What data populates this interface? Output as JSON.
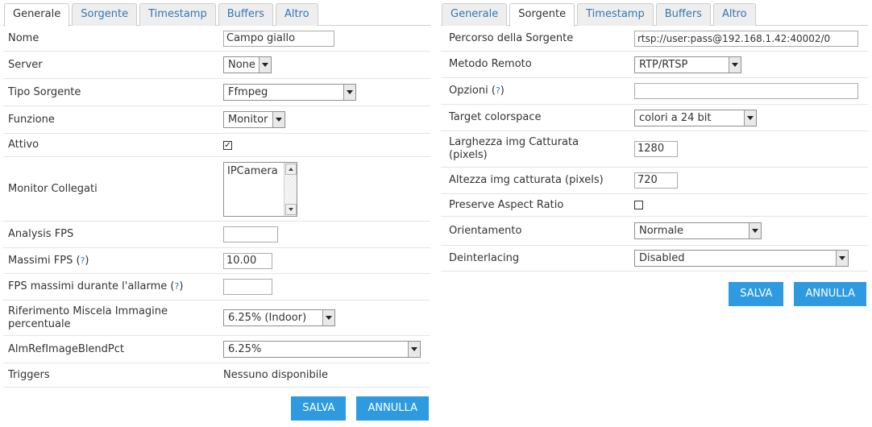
{
  "left": {
    "tabs": [
      "Generale",
      "Sorgente",
      "Timestamp",
      "Buffers",
      "Altro"
    ],
    "active_tab": 0,
    "fields": {
      "nome": {
        "label": "Nome",
        "value": "Campo giallo"
      },
      "server": {
        "label": "Server",
        "value": "None"
      },
      "tipo_sorgente": {
        "label": "Tipo Sorgente",
        "value": "Ffmpeg"
      },
      "funzione": {
        "label": "Funzione",
        "value": "Monitor"
      },
      "attivo": {
        "label": "Attivo",
        "checked": true,
        "check_glyph": "✓"
      },
      "monitor_collegati": {
        "label": "Monitor Collegati",
        "options": [
          "IPCamera"
        ]
      },
      "analysis_fps": {
        "label": "Analysis FPS",
        "value": ""
      },
      "massimi_fps": {
        "label": "Massimi FPS (",
        "help": "?",
        "suffix": ")",
        "value": "10.00"
      },
      "fps_allarme": {
        "label": "FPS massimi durante l'allarme (",
        "help": "?",
        "suffix": ")",
        "value": ""
      },
      "rif_miscela": {
        "label": "Riferimento Miscela Immagine percentuale",
        "value": "6.25% (Indoor)"
      },
      "alm_ref": {
        "label": "AlmRefImageBlendPct",
        "value": "6.25%"
      },
      "triggers": {
        "label": "Triggers",
        "value": "Nessuno disponibile"
      }
    },
    "save_label": "SALVA",
    "cancel_label": "ANNULLA"
  },
  "right": {
    "tabs": [
      "Generale",
      "Sorgente",
      "Timestamp",
      "Buffers",
      "Altro"
    ],
    "active_tab": 1,
    "fields": {
      "percorso": {
        "label": "Percorso della Sorgente",
        "value": "rtsp://user:pass@192.168.1.42:40002/0"
      },
      "metodo": {
        "label": "Metodo Remoto",
        "value": "RTP/RTSP"
      },
      "opzioni": {
        "label": "Opzioni (",
        "help": "?",
        "suffix": ")",
        "value": ""
      },
      "colorspace": {
        "label": "Target colorspace",
        "value": "colori a 24 bit"
      },
      "larghezza": {
        "label": "Larghezza img Catturata (pixels)",
        "value": "1280"
      },
      "altezza": {
        "label": "Altezza img catturata (pixels)",
        "value": "720"
      },
      "aspect": {
        "label": "Preserve Aspect Ratio",
        "checked": false
      },
      "orientamento": {
        "label": "Orientamento",
        "value": "Normale"
      },
      "deinterlacing": {
        "label": "Deinterlacing",
        "value": "Disabled"
      }
    },
    "save_label": "SALVA",
    "cancel_label": "ANNULLA"
  },
  "colors": {
    "accent": "#2e9be0",
    "link": "#3277b6"
  }
}
